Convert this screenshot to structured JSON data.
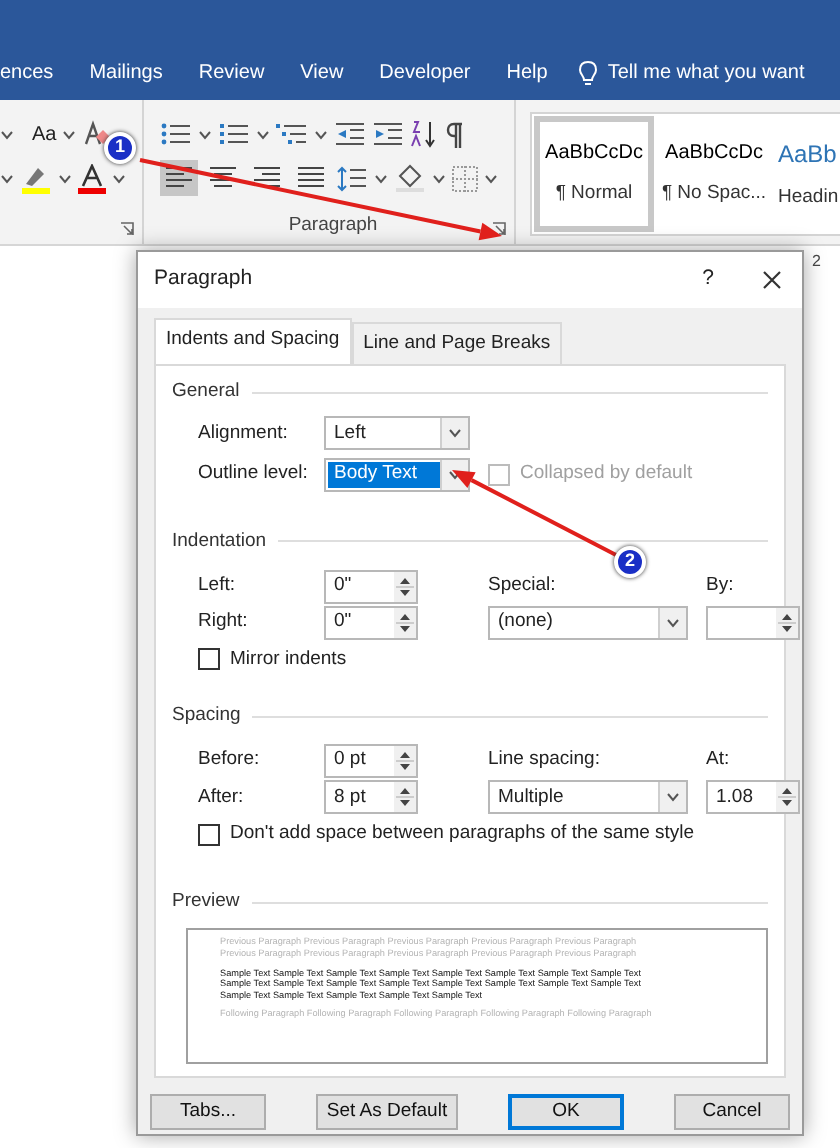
{
  "ribbon_tabs": [
    {
      "label": "ences"
    },
    {
      "label": "Mailings"
    },
    {
      "label": "Review"
    },
    {
      "label": "View"
    },
    {
      "label": "Developer"
    },
    {
      "label": "Help"
    }
  ],
  "tell_me": "Tell me what you want",
  "ribbon": {
    "change_case": "Aa",
    "paragraph_group": "Paragraph",
    "alignments": [
      {
        "selected": true
      },
      {
        "selected": false
      },
      {
        "selected": false
      },
      {
        "selected": false
      }
    ],
    "styles": [
      {
        "sample": "AaBbCcDc",
        "name": "¶ Normal",
        "selected": true,
        "kind": "body"
      },
      {
        "sample": "AaBbCcDc",
        "name": "¶ No Spac...",
        "selected": false,
        "kind": "body"
      },
      {
        "sample": "AaBb",
        "name": "Headin",
        "selected": false,
        "kind": "heading"
      }
    ]
  },
  "ruler_mark": "2",
  "callouts": [
    {
      "label": "1"
    },
    {
      "label": "2"
    }
  ],
  "dialog": {
    "title": "Paragraph",
    "help": "?",
    "tabs": [
      {
        "label": "Indents and Spacing",
        "selected": true
      },
      {
        "label": "Line and Page Breaks",
        "selected": false
      }
    ],
    "general": {
      "heading": "General",
      "alignment": {
        "label": "Alignment:",
        "value": "Left"
      },
      "outline_level": {
        "label": "Outline level:",
        "value": "Body Text",
        "highlighted": true
      },
      "collapsed": {
        "label": "Collapsed by default",
        "checked": false,
        "disabled": true
      }
    },
    "indentation": {
      "heading": "Indentation",
      "left": {
        "label": "Left:",
        "value": "0\""
      },
      "right": {
        "label": "Right:",
        "value": "0\""
      },
      "special": {
        "label": "Special:",
        "value": "(none)"
      },
      "by": {
        "label": "By:"
      },
      "mirror": {
        "label": "Mirror indents",
        "checked": false
      }
    },
    "spacing": {
      "heading": "Spacing",
      "before": {
        "label": "Before:",
        "value": "0 pt"
      },
      "after": {
        "label": "After:",
        "value": "8 pt"
      },
      "line_spacing": {
        "label": "Line spacing:",
        "value": "Multiple"
      },
      "at": {
        "label": "At:",
        "value": "1.08"
      },
      "dont_add": {
        "label": "Don't add space between paragraphs of the same style",
        "checked": false
      }
    },
    "preview": {
      "heading": "Preview",
      "previous_lines": [
        "Previous Paragraph Previous Paragraph Previous Paragraph Previous Paragraph Previous Paragraph",
        "Previous Paragraph Previous Paragraph Previous Paragraph Previous Paragraph Previous Paragraph"
      ],
      "sample_lines": [
        "Sample Text Sample Text Sample Text Sample Text Sample Text Sample Text Sample Text Sample Text",
        "Sample Text Sample Text Sample Text Sample Text Sample Text Sample Text Sample Text Sample Text",
        "Sample Text Sample Text Sample Text Sample Text Sample Text"
      ],
      "following_lines": [
        "Following Paragraph Following Paragraph Following Paragraph Following Paragraph Following Paragraph"
      ]
    },
    "buttons": [
      {
        "label": "Tabs...",
        "default": false
      },
      {
        "label": "Set As Default",
        "default": false
      },
      {
        "label": "OK",
        "default": true
      },
      {
        "label": "Cancel",
        "default": false
      }
    ]
  }
}
